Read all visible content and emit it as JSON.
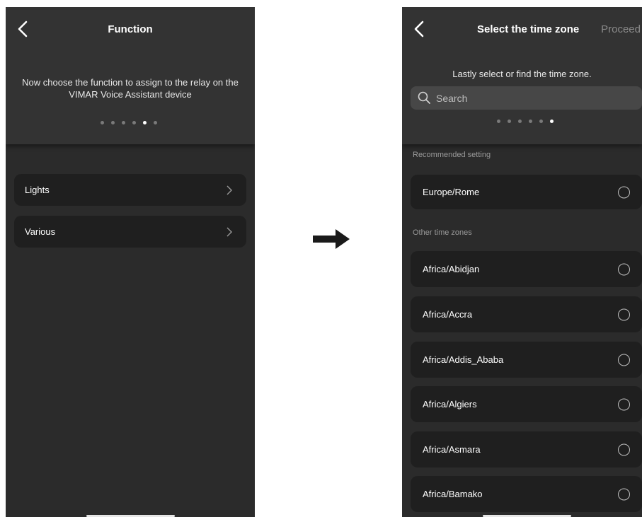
{
  "left": {
    "title": "Function",
    "subtitle": "Now choose the function to assign to the relay on the VIMAR Voice Assistant device",
    "page_indicator": {
      "count": 6,
      "active": 5
    },
    "items": [
      {
        "label": "Lights"
      },
      {
        "label": "Various"
      }
    ]
  },
  "right": {
    "title": "Select the time zone",
    "proceed_label": "Proceed",
    "subtitle": "Lastly select or find the time zone.",
    "search": {
      "placeholder": "Search"
    },
    "page_indicator": {
      "count": 6,
      "active": 6
    },
    "recommended_label": "Recommended setting",
    "recommended": [
      {
        "label": "Europe/Rome"
      }
    ],
    "other_label": "Other time zones",
    "zones": [
      {
        "label": "Africa/Abidjan"
      },
      {
        "label": "Africa/Accra"
      },
      {
        "label": "Africa/Addis_Ababa"
      },
      {
        "label": "Africa/Algiers"
      },
      {
        "label": "Africa/Asmara"
      },
      {
        "label": "Africa/Bamako"
      }
    ]
  },
  "arrow_icon": "right-arrow-icon",
  "colors": {
    "screen_bg": "#2b2b2b",
    "header_bg": "#333333",
    "item_bg": "#1f1f1f",
    "proceed": "#8a8a8a"
  }
}
